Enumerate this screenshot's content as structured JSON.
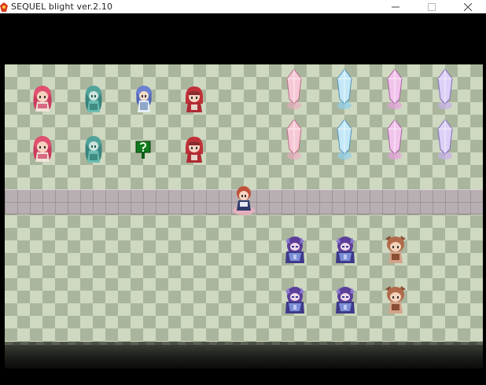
{
  "window": {
    "title": "SEQUEL blight ver.2.10",
    "icon": "app-icon",
    "controls": [
      "minimize-icon",
      "maximize-icon",
      "close-icon"
    ]
  },
  "colors": {
    "floor_light": "#cfd8c0",
    "floor_dark": "#a9b69d",
    "path": "#b7afb2",
    "crystal_pink": "#f0a8c0",
    "crystal_blue": "#8fd0f0",
    "crystal_magenta": "#e8a0e0",
    "crystal_violet": "#c8b0f0"
  },
  "npcs": [
    {
      "id": "pink-girl-1",
      "icon": "pink-haired-girl-sprite",
      "hair": "#e05070"
    },
    {
      "id": "teal-girl-1",
      "icon": "teal-girl-sprite",
      "hair": "#4fa39a"
    },
    {
      "id": "blue-girl",
      "icon": "blue-haired-girl-sprite",
      "hair": "#6a7fd0"
    },
    {
      "id": "red-hood-1",
      "icon": "red-hooded-girl-sprite",
      "hair": "#c03038"
    },
    {
      "id": "pink-girl-2",
      "icon": "pink-haired-girl-sprite",
      "hair": "#e05070"
    },
    {
      "id": "teal-girl-2",
      "icon": "teal-girl-sprite",
      "hair": "#4fa39a"
    },
    {
      "id": "red-hood-2",
      "icon": "red-hooded-girl-sprite",
      "hair": "#c03038"
    },
    {
      "id": "player",
      "icon": "player-sprite",
      "hair": "#c05038"
    },
    {
      "id": "armor-knight-1",
      "icon": "armored-knight-sprite",
      "hair": "#5b3f9a"
    },
    {
      "id": "armor-knight-2",
      "icon": "armored-knight-sprite",
      "hair": "#5b3f9a"
    },
    {
      "id": "beast-girl-1",
      "icon": "beast-girl-sprite",
      "hair": "#b06a4a"
    },
    {
      "id": "armor-knight-3",
      "icon": "armored-knight-sprite",
      "hair": "#5b3f9a"
    },
    {
      "id": "armor-knight-4",
      "icon": "armored-knight-sprite",
      "hair": "#5b3f9a"
    },
    {
      "id": "beast-girl-2",
      "icon": "beast-girl-sprite",
      "hair": "#b06a4a"
    }
  ],
  "objects": [
    {
      "id": "question-sign",
      "icon": "question-mark-sign-icon"
    }
  ],
  "crystals": [
    {
      "id": "crystal-pink-1",
      "icon": "pink-crystal-icon"
    },
    {
      "id": "crystal-blue-1",
      "icon": "blue-crystal-icon"
    },
    {
      "id": "crystal-magenta-1",
      "icon": "magenta-crystal-icon"
    },
    {
      "id": "crystal-violet-1",
      "icon": "violet-crystal-icon"
    },
    {
      "id": "crystal-pink-2",
      "icon": "pink-crystal-icon"
    },
    {
      "id": "crystal-blue-2",
      "icon": "blue-crystal-icon"
    },
    {
      "id": "crystal-magenta-2",
      "icon": "magenta-crystal-icon"
    },
    {
      "id": "crystal-violet-2",
      "icon": "violet-crystal-icon"
    }
  ]
}
